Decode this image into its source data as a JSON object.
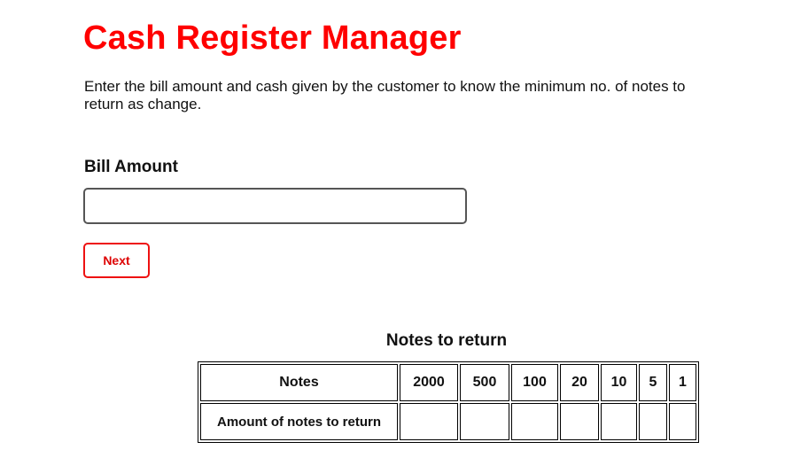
{
  "header": {
    "title": "Cash Register Manager",
    "subtitle": "Enter the bill amount and cash given by the customer to know the minimum no. of notes to return as change."
  },
  "form": {
    "bill_label": "Bill Amount",
    "bill_value": "",
    "next_label": "Next"
  },
  "change_table": {
    "caption": "Notes to return",
    "row_header_notes": "Notes",
    "row_header_amount": "Amount of notes to return",
    "denominations": [
      "2000",
      "500",
      "100",
      "20",
      "10",
      "5",
      "1"
    ],
    "counts": [
      "",
      "",
      "",
      "",
      "",
      "",
      ""
    ]
  },
  "colors": {
    "accent": "#ff0000",
    "text": "#111111",
    "input_border": "#555555"
  }
}
